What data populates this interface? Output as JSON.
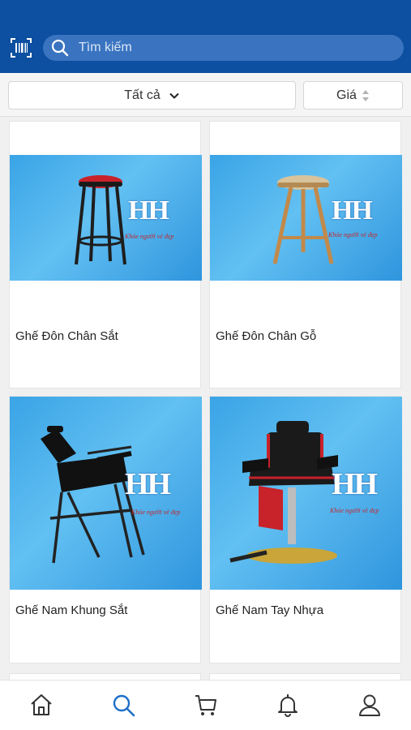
{
  "search": {
    "placeholder": "Tìm kiếm"
  },
  "filters": {
    "all_label": "Tất cả",
    "price_label": "Giá"
  },
  "watermark": {
    "logo": "HH",
    "tagline": "Khỏe người vẻ đẹp"
  },
  "products": [
    {
      "name": "Ghế Đôn Chân Sắt"
    },
    {
      "name": "Ghế Đôn Chân Gỗ"
    },
    {
      "name": "Ghế Nam Khung Sắt"
    },
    {
      "name": "Ghế Nam Tay Nhựa"
    }
  ],
  "tabs": [
    {
      "icon": "home-icon"
    },
    {
      "icon": "search-icon",
      "active": true
    },
    {
      "icon": "cart-icon"
    },
    {
      "icon": "bell-icon"
    },
    {
      "icon": "user-icon"
    }
  ],
  "colors": {
    "header": "#0d4fa0",
    "accent": "#1f6fc8",
    "search_box": "#3a74c0"
  }
}
